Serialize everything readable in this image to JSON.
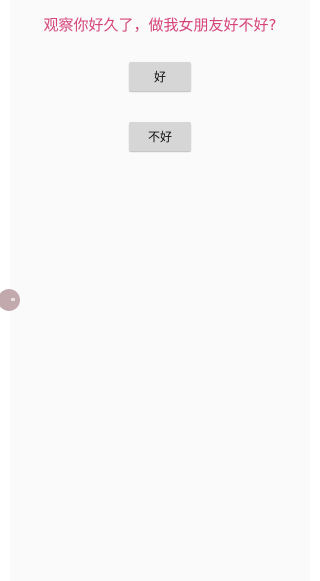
{
  "question": {
    "text": "观察你好久了，做我女朋友好不好?",
    "color": "#d6447a"
  },
  "buttons": {
    "yes_label": "好",
    "no_label": "不好"
  },
  "floating_handle": {
    "icon": "assistive-touch-icon",
    "color": "#c2a9ad"
  },
  "colors": {
    "background": "#fafafa",
    "button_bg": "#d6d6d6"
  }
}
